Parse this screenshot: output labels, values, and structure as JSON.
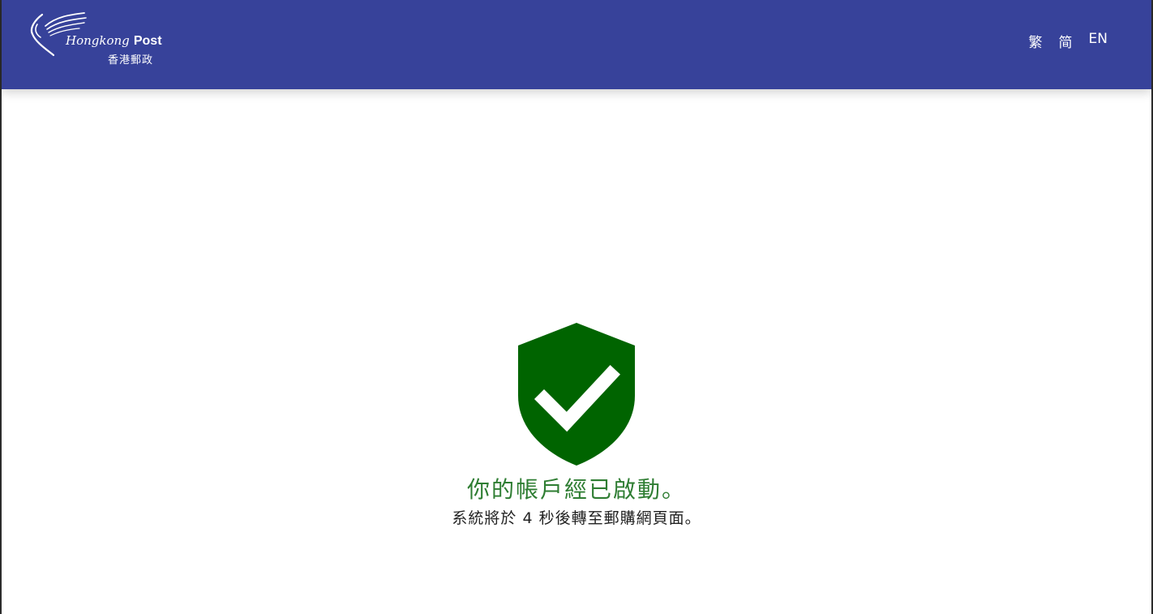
{
  "header": {
    "logo": {
      "name_prefix": "Hongkong",
      "name_suffix": "Post",
      "name_chinese": "香港郵政"
    },
    "languages": [
      "繁",
      "简",
      "EN"
    ]
  },
  "colors": {
    "header_bg": "#37429a",
    "shield_green": "#006400",
    "title_green": "#2e7d32"
  },
  "main": {
    "icon": "shield-check-icon",
    "title": "你的帳戶經已啟動。",
    "subtitle": "系統將於 4 秒後轉至郵購網頁面。"
  }
}
